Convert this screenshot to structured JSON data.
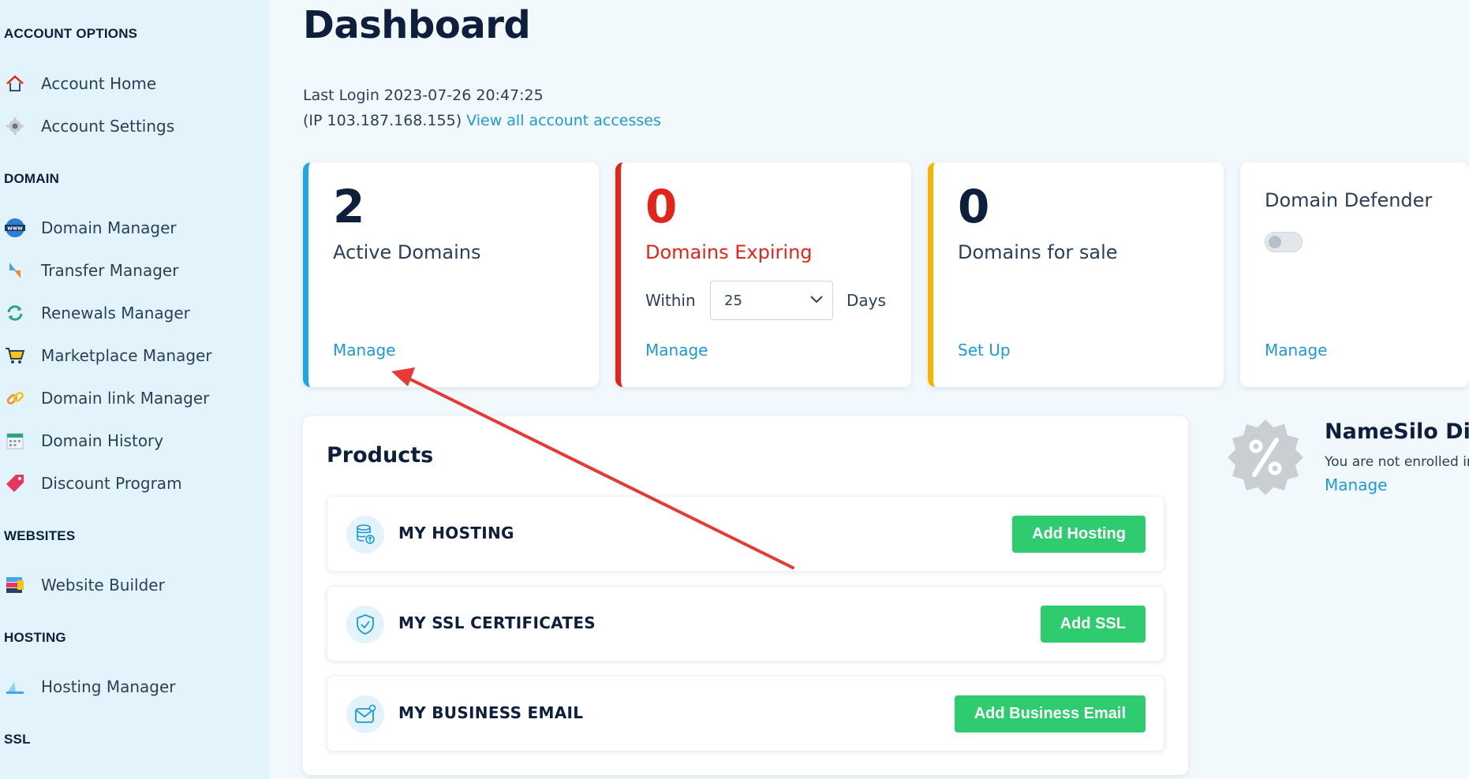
{
  "sidebar": {
    "sections": {
      "account_options": "ACCOUNT OPTIONS",
      "domain": "DOMAIN",
      "websites": "WEBSITES",
      "hosting": "HOSTING",
      "ssl": "SSL"
    },
    "items": {
      "account_home": "Account Home",
      "account_settings": "Account Settings",
      "domain_manager": "Domain Manager",
      "transfer_manager": "Transfer Manager",
      "renewals_manager": "Renewals Manager",
      "marketplace_manager": "Marketplace Manager",
      "domain_link_manager": "Domain link Manager",
      "domain_history": "Domain History",
      "discount_program": "Discount Program",
      "website_builder": "Website Builder",
      "hosting_manager": "Hosting Manager"
    }
  },
  "main": {
    "title": "Dashboard",
    "last_login": "Last Login 2023-07-26 20:47:25",
    "ip": "(IP 103.187.168.155)",
    "view_accesses": "View all account accesses"
  },
  "cards": {
    "active": {
      "count": "2",
      "label": "Active Domains",
      "link": "Manage",
      "color": "#1ea7e4"
    },
    "expiring": {
      "count": "0",
      "label": "Domains Expiring",
      "within": "Within",
      "days_value": "25",
      "days": "Days",
      "link": "Manage",
      "color": "#e1251b"
    },
    "for_sale": {
      "count": "0",
      "label": "Domains for sale",
      "link": "Set Up",
      "color": "#f5b400"
    },
    "defender": {
      "label": "Domain Defender",
      "toggle": "off",
      "link": "Manage"
    }
  },
  "products": {
    "title": "Products",
    "rows": {
      "hosting": {
        "label": "MY HOSTING",
        "button": "Add Hosting"
      },
      "ssl": {
        "label": "MY SSL CERTIFICATES",
        "button": "Add SSL"
      },
      "email": {
        "label": "MY BUSINESS EMAIL",
        "button": "Add Business Email"
      }
    }
  },
  "discount": {
    "title": "NameSilo Disc",
    "text": "You are not enrolled in",
    "link": "Manage"
  }
}
